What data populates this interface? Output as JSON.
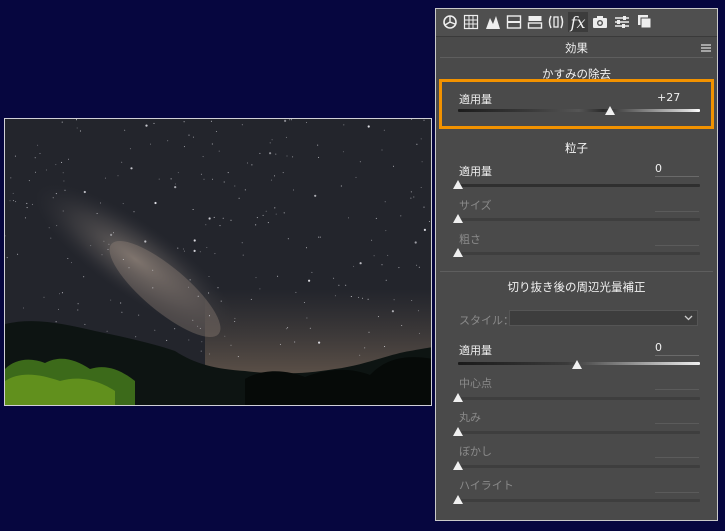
{
  "toolbar": {
    "icons": [
      "basic-panel-icon",
      "tone-curve-icon",
      "detail-icon",
      "hsl-icon",
      "split-toning-icon",
      "lens-corrections-icon",
      "effects-icon",
      "camera-calibration-icon",
      "presets-icon",
      "snapshots-icon"
    ],
    "effects_glyph": "fx"
  },
  "panel": {
    "title": "効果",
    "dehaze": {
      "title": "かすみの除去",
      "amount_label": "適用量",
      "amount_value": "+27",
      "amount": 27,
      "min": -100,
      "max": 100
    },
    "grain": {
      "title": "粒子",
      "amount_label": "適用量",
      "amount_value": "0",
      "size_label": "サイズ",
      "roughness_label": "粗さ"
    },
    "vignette": {
      "title": "切り抜き後の周辺光量補正",
      "style_label": "スタイル：",
      "amount_label": "適用量",
      "amount_value": "0",
      "midpoint_label": "中心点",
      "roundness_label": "丸み",
      "feather_label": "ぼかし",
      "highlights_label": "ハイライト"
    }
  },
  "colors": {
    "background": "#06063f",
    "panel": "#4a4a4a",
    "highlight": "#f29200"
  }
}
